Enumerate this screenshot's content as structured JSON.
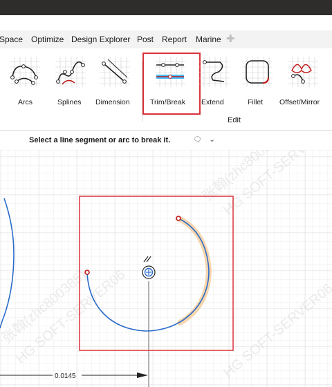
{
  "menu": {
    "items": [
      "Space",
      "Optimize",
      "Design Explorer",
      "Post",
      "Report",
      "Marine"
    ],
    "add_icon": "plus-icon"
  },
  "ribbon": {
    "tools": [
      "Arcs",
      "Splines",
      "Dimension",
      "Trim/Break",
      "Extend",
      "Fillet",
      "Offset/Mirror"
    ],
    "selected_tool": "Trim/Break",
    "group_label": "Edit"
  },
  "prompt": {
    "text": "Select a line segment or arc to break it.",
    "icons": [
      "comment-icon",
      "expand-chevron-icon"
    ]
  },
  "canvas": {
    "dimension_value": "0.0145",
    "watermarks": [
      "张翰(zhc800385)",
      "HG SOFT-SERVER06"
    ]
  },
  "colors": {
    "title_bar": "#2f2c2c",
    "curve": "#2a6bc9",
    "highlight": "#f6cfa0",
    "selection": "#d9323a",
    "endpoint": "#c01818"
  }
}
